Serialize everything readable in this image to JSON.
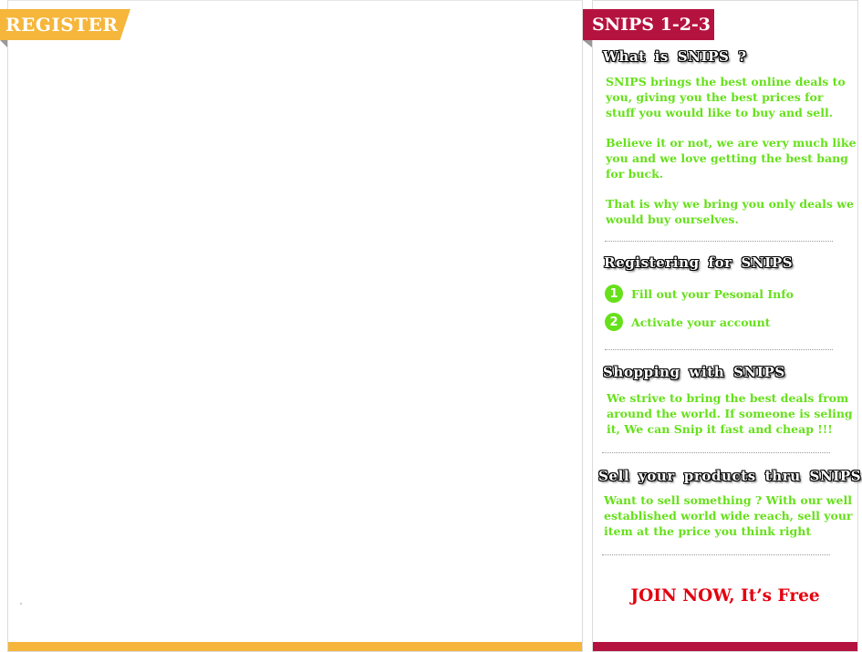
{
  "register": {
    "title": "REGISTER",
    "accent": "#f5b63b"
  },
  "sidebar": {
    "title": "SNIPS 1-2-3",
    "accent": "#b5133f",
    "text_color": "#66e01a",
    "what": {
      "heading": "What is SNIPS ?",
      "p1": "SNIPS brings the best online deals to you, giving you the best prices for stuff you would like to buy and sell.",
      "p2": "Believe it or not, we are very much like you and we love getting the best bang for buck.",
      "p3": "That is why we bring you only deals we would buy ourselves."
    },
    "registering": {
      "heading": "Registering for SNIPS",
      "steps": [
        {
          "num": "1",
          "label": "Fill out your Pesonal Info"
        },
        {
          "num": "2",
          "label": "Activate your account"
        }
      ]
    },
    "shopping": {
      "heading": "Shopping with SNIPS",
      "text": "We strive to bring the best deals from around the world. If someone is seling it, We can Snip it fast and cheap !!!"
    },
    "sell": {
      "heading": "Sell your products thru SNIPS",
      "text": "Want to sell something ? With our well established world wide reach, sell your item at the price you think right"
    },
    "join": {
      "label": "JOIN NOW, It’s Free",
      "color": "#e3000f"
    }
  }
}
